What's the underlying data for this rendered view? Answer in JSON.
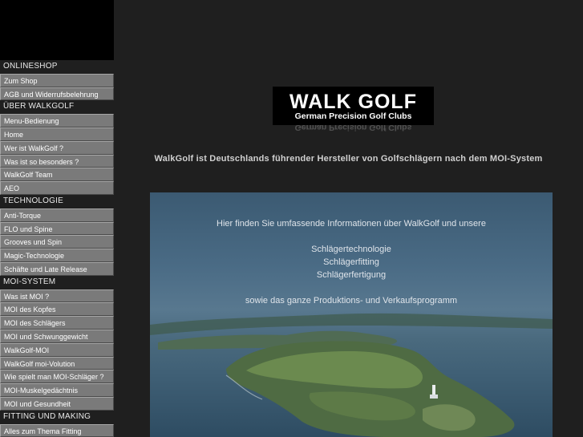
{
  "sidebar": {
    "sections": [
      {
        "header": "ONLINESHOP",
        "items": [
          "Zum Shop",
          "AGB und Widerrufsbelehrung"
        ]
      },
      {
        "header": "ÜBER WALKGOLF",
        "items": [
          "Menu-Bedienung",
          "Home",
          "Wer ist WalkGolf ?",
          "Was ist so besonders ?",
          "WalkGolf Team",
          "AEO"
        ]
      },
      {
        "header": "TECHNOLOGIE",
        "items": [
          "Anti-Torque",
          "FLO und Spine",
          "Grooves und Spin",
          "Magic-Technologie",
          "Schäfte und Late Release"
        ]
      },
      {
        "header": "MOI-SYSTEM",
        "items": [
          "Was ist MOI ?",
          "MOI des Kopfes",
          "MOI des Schlägers",
          "MOI und Schwunggewicht",
          "WalkGolf-MOI",
          "WalkGolf moi-Volution",
          "Wie spielt man MOI-Schläger ?",
          "MOI-Muskelgedächtnis",
          "MOI und Gesundheit"
        ]
      },
      {
        "header": "FITTING UND MAKING",
        "items": [
          "Alles zum Thema Fitting"
        ]
      }
    ]
  },
  "logo": {
    "wordmark": "WALK GOLF",
    "tagline": "German Precision Golf Clubs"
  },
  "main": {
    "headline": "WalkGolf ist Deutschlands führender Hersteller von Golfschlägern nach dem MOI-System",
    "hero": {
      "intro": "Hier finden Sie umfassende Informationen über WalkGolf und unsere",
      "topics": [
        "Schlägertechnologie",
        "Schlägerfitting",
        "Schlägerfertigung"
      ],
      "outro": "sowie das ganze Produktions- und Verkaufsprogramm"
    }
  },
  "colors": {
    "background": "#1f1f1f",
    "menu_item_bg": "#7a7a7a",
    "logo_bg": "#000000"
  }
}
